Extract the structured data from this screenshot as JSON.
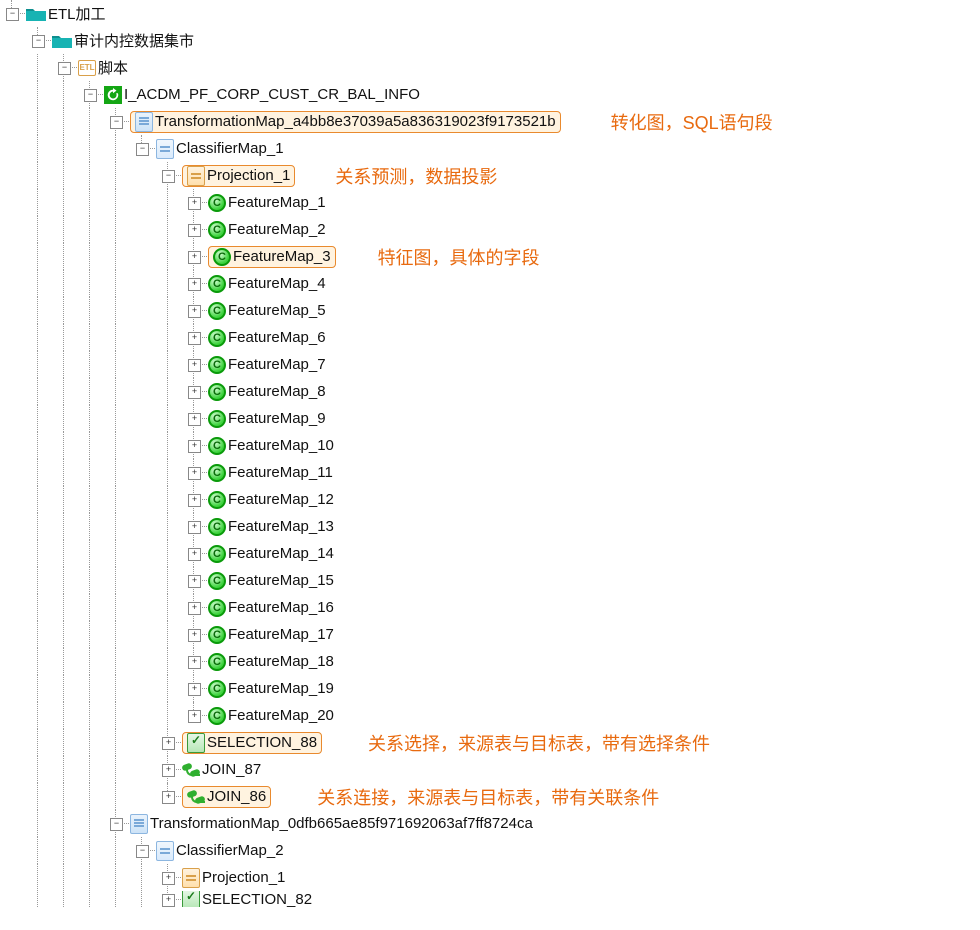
{
  "tree": {
    "root": "ETL加工",
    "level1": "审计内控数据集市",
    "level2": "脚本",
    "etl_badge": "ETL",
    "level3": "I_ACDM_PF_CORP_CUST_CR_BAL_INFO",
    "tmap1": "TransformationMap_a4bb8e37039a5a836319023f9173521b",
    "cmap1": "ClassifierMap_1",
    "proj1": "Projection_1",
    "feature_prefix": "FeatureMap_",
    "features": [
      "1",
      "2",
      "3",
      "4",
      "5",
      "6",
      "7",
      "8",
      "9",
      "10",
      "11",
      "12",
      "13",
      "14",
      "15",
      "16",
      "17",
      "18",
      "19",
      "20"
    ],
    "selection88": "SELECTION_88",
    "join87": "JOIN_87",
    "join86": "JOIN_86",
    "tmap2": "TransformationMap_0dfb665ae85f971692063af7ff8724ca",
    "cmap2": "ClassifierMap_2",
    "proj2": "Projection_1",
    "sel82": "SELECTION_82"
  },
  "annotations": {
    "tmap": "转化图，SQL语句段",
    "proj": "关系预测，数据投影",
    "feat": "特征图，具体的字段",
    "sel": "关系选择，来源表与目标表，带有选择条件",
    "join": "关系连接，来源表与目标表，带有关联条件"
  },
  "glyphs": {
    "plus": "+",
    "minus": "−"
  }
}
